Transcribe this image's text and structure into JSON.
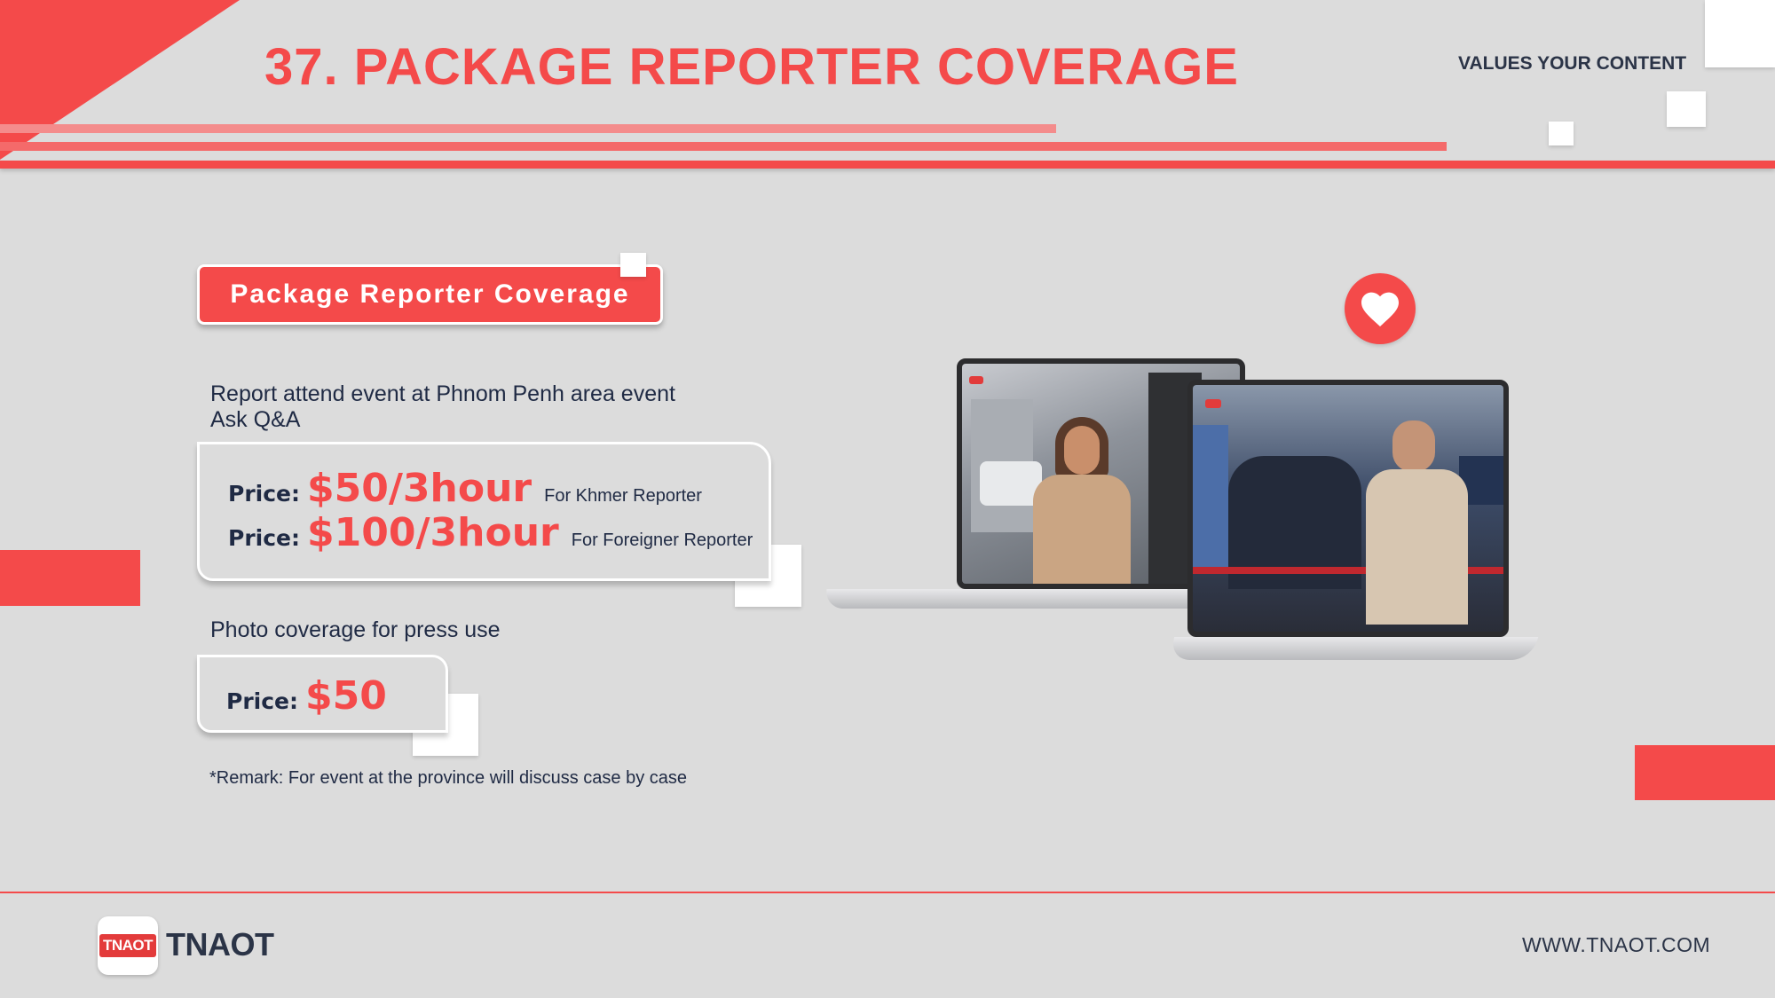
{
  "header": {
    "title": "37. PACKAGE REPORTER COVERAGE",
    "tagline": "VALUES YOUR CONTENT"
  },
  "content": {
    "pill_label": "Package Reporter Coverage",
    "event_desc_line1": "Report attend event at Phnom Penh area event",
    "event_desc_line2": "Ask Q&A",
    "prices": [
      {
        "label": "Price:",
        "value": "$50/3hour",
        "note": "For Khmer Reporter"
      },
      {
        "label": "Price:",
        "value": "$100/3hour",
        "note": "For Foreigner Reporter"
      }
    ],
    "photo_desc": "Photo coverage for press use",
    "photo_price": {
      "label": "Price:",
      "value": "$50"
    },
    "remark": "*Remark: For event at the province will discuss case by case"
  },
  "footer": {
    "logo_badge": "TNAOT",
    "logo_text": "TNAOT",
    "website": "WWW.TNAOT.COM"
  },
  "icons": {
    "heart": "heart-icon"
  },
  "colors": {
    "accent": "#f44a4a",
    "text_dark": "#1f2a44",
    "background": "#dcdcdc"
  }
}
